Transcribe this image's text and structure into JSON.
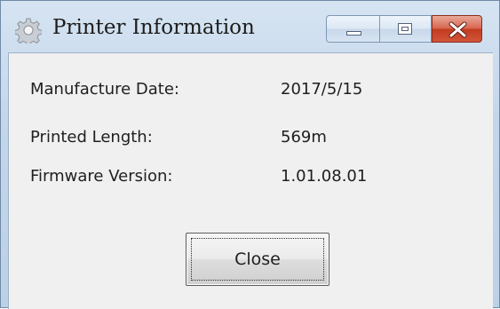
{
  "window": {
    "title": "Printer Information",
    "icon": "gear-icon",
    "caption_buttons": [
      "minimize",
      "maximize",
      "close"
    ],
    "colors": {
      "titlebar": "#c3d6ea",
      "close_button": "#c94a2e",
      "client_background": "#f0f0f0"
    }
  },
  "info": {
    "rows": [
      {
        "label": "Manufacture Date:",
        "value": "2017/5/15"
      },
      {
        "label": "Printed Length:",
        "value": "569m"
      },
      {
        "label": "Firmware Version:",
        "value": "1.01.08.01"
      }
    ]
  },
  "actions": {
    "close_label": "Close"
  }
}
